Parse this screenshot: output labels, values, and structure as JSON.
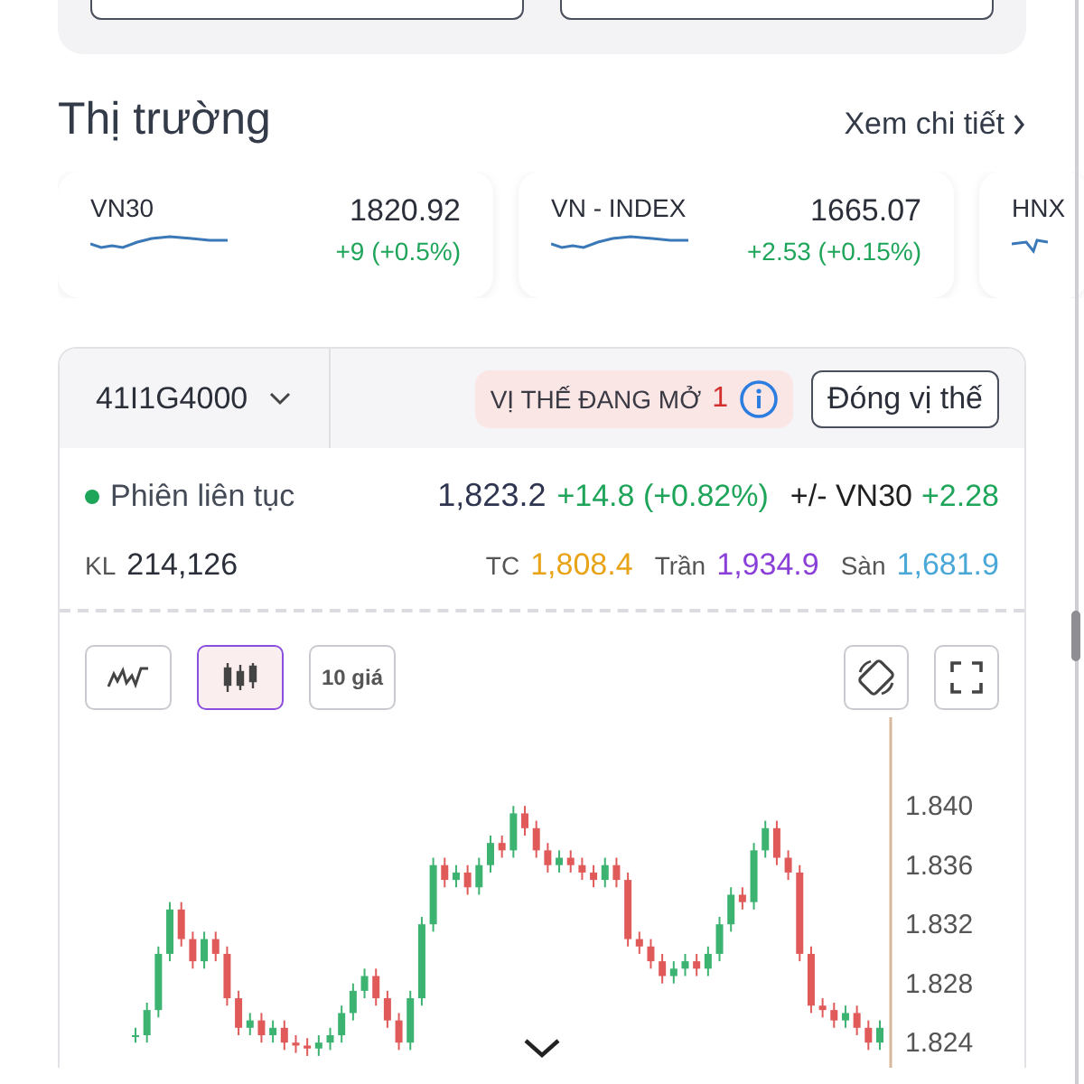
{
  "market": {
    "title": "Thị trường",
    "link": "Xem chi tiết",
    "indices": [
      {
        "name": "VN30",
        "value": "1820.92",
        "change": "+9 (+0.5%)"
      },
      {
        "name": "VN - INDEX",
        "value": "1665.07",
        "change": "+2.53 (+0.15%)"
      },
      {
        "name": "HNX"
      }
    ]
  },
  "contract": {
    "symbol": "41I1G4000",
    "positions_label": "VỊ THẾ ĐANG MỞ",
    "positions_count": "1",
    "close_button": "Đóng vị thế",
    "session": "Phiên liên tục",
    "price": "1,823.2",
    "change": "+14.8 (+0.82%)",
    "basis_label": "+/- VN30",
    "basis": "+2.28",
    "volume_label": "KL",
    "volume": "214,126",
    "ref_label": "TC",
    "ref": "1,808.4",
    "ceiling_label": "Trần",
    "ceiling": "1,934.9",
    "floor_label": "Sàn",
    "floor": "1,681.9"
  },
  "chart_tools": [
    {
      "kind": "line",
      "selected": false
    },
    {
      "kind": "candle",
      "selected": true
    },
    {
      "kind": "text",
      "label": "10 giá",
      "selected": false
    }
  ],
  "chart": {
    "chart_data": {
      "type": "candlestick",
      "ylim": [
        1.8223,
        1.846
      ],
      "yticks": [
        {
          "value": 1.84,
          "label": "1.840"
        },
        {
          "value": 1.836,
          "label": "1.836"
        },
        {
          "value": 1.832,
          "label": "1.832"
        },
        {
          "value": 1.828,
          "label": "1.828"
        },
        {
          "value": 1.824,
          "label": "1.824"
        }
      ],
      "categories": [
        null,
        null,
        null,
        null,
        null,
        null,
        null,
        null,
        null,
        null,
        null,
        null,
        null,
        null,
        null,
        null,
        null,
        null,
        null,
        null,
        null,
        null,
        null,
        null,
        null,
        null,
        null,
        null,
        null,
        null,
        null,
        null,
        null,
        null,
        null,
        null,
        null,
        null,
        null,
        null,
        null,
        null,
        null,
        null,
        null,
        null,
        null,
        null,
        null,
        null,
        null,
        null,
        null,
        null,
        null,
        null,
        null,
        null,
        null,
        null,
        null,
        null,
        null,
        null,
        null,
        null
      ],
      "ohlc": [
        [
          1.8245,
          1.825,
          1.824,
          1.8245
        ],
        [
          1.8245,
          1.8267,
          1.824,
          1.8262
        ],
        [
          1.8262,
          1.8305,
          1.8257,
          1.83
        ],
        [
          1.83,
          1.8335,
          1.8295,
          1.833
        ],
        [
          1.833,
          1.8335,
          1.8305,
          1.831
        ],
        [
          1.831,
          1.8315,
          1.829,
          1.8295
        ],
        [
          1.8295,
          1.8315,
          1.829,
          1.831
        ],
        [
          1.831,
          1.8315,
          1.8295,
          1.83
        ],
        [
          1.83,
          1.8305,
          1.8265,
          1.827
        ],
        [
          1.827,
          1.8275,
          1.8245,
          1.825
        ],
        [
          1.825,
          1.826,
          1.8245,
          1.8255
        ],
        [
          1.8255,
          1.826,
          1.824,
          1.8245
        ],
        [
          1.8245,
          1.8255,
          1.824,
          1.825
        ],
        [
          1.825,
          1.8255,
          1.8235,
          1.824
        ],
        [
          1.824,
          1.8245,
          1.8233,
          1.8238
        ],
        [
          1.8238,
          1.8243,
          1.8231,
          1.8236
        ],
        [
          1.8236,
          1.8245,
          1.8231,
          1.824
        ],
        [
          1.824,
          1.825,
          1.8235,
          1.8245
        ],
        [
          1.8245,
          1.8265,
          1.824,
          1.826
        ],
        [
          1.826,
          1.828,
          1.8255,
          1.8275
        ],
        [
          1.8275,
          1.829,
          1.827,
          1.8285
        ],
        [
          1.8285,
          1.829,
          1.8265,
          1.827
        ],
        [
          1.827,
          1.8275,
          1.825,
          1.8255
        ],
        [
          1.8255,
          1.826,
          1.8235,
          1.824
        ],
        [
          1.824,
          1.8275,
          1.8235,
          1.827
        ],
        [
          1.827,
          1.8325,
          1.8265,
          1.832
        ],
        [
          1.832,
          1.8365,
          1.8315,
          1.836
        ],
        [
          1.836,
          1.8365,
          1.8345,
          1.835
        ],
        [
          1.835,
          1.836,
          1.8345,
          1.8355
        ],
        [
          1.8355,
          1.836,
          1.834,
          1.8345
        ],
        [
          1.8345,
          1.8365,
          1.834,
          1.836
        ],
        [
          1.836,
          1.838,
          1.8355,
          1.8375
        ],
        [
          1.8375,
          1.838,
          1.8365,
          1.837
        ],
        [
          1.837,
          1.84,
          1.8365,
          1.8395
        ],
        [
          1.8395,
          1.84,
          1.838,
          1.8385
        ],
        [
          1.8385,
          1.839,
          1.8365,
          1.837
        ],
        [
          1.837,
          1.8375,
          1.8355,
          1.836
        ],
        [
          1.836,
          1.837,
          1.8355,
          1.8365
        ],
        [
          1.8365,
          1.837,
          1.8355,
          1.836
        ],
        [
          1.836,
          1.8365,
          1.835,
          1.8355
        ],
        [
          1.8355,
          1.836,
          1.8345,
          1.835
        ],
        [
          1.835,
          1.8365,
          1.8345,
          1.836
        ],
        [
          1.836,
          1.8365,
          1.8345,
          1.835
        ],
        [
          1.835,
          1.8355,
          1.8305,
          1.831
        ],
        [
          1.831,
          1.8315,
          1.83,
          1.8305
        ],
        [
          1.8305,
          1.831,
          1.829,
          1.8295
        ],
        [
          1.8295,
          1.83,
          1.828,
          1.8285
        ],
        [
          1.8285,
          1.8295,
          1.828,
          1.829
        ],
        [
          1.829,
          1.83,
          1.8285,
          1.8295
        ],
        [
          1.8295,
          1.83,
          1.8285,
          1.829
        ],
        [
          1.829,
          1.8305,
          1.8285,
          1.83
        ],
        [
          1.83,
          1.8325,
          1.8295,
          1.832
        ],
        [
          1.832,
          1.8345,
          1.8315,
          1.834
        ],
        [
          1.834,
          1.8345,
          1.833,
          1.8335
        ],
        [
          1.8335,
          1.8375,
          1.833,
          1.837
        ],
        [
          1.837,
          1.839,
          1.8365,
          1.8385
        ],
        [
          1.8385,
          1.839,
          1.836,
          1.8365
        ],
        [
          1.8365,
          1.837,
          1.835,
          1.8355
        ],
        [
          1.8355,
          1.836,
          1.8295,
          1.83
        ],
        [
          1.83,
          1.8305,
          1.826,
          1.8265
        ],
        [
          1.8265,
          1.827,
          1.8257,
          1.8262
        ],
        [
          1.8262,
          1.8267,
          1.825,
          1.8255
        ],
        [
          1.8255,
          1.8265,
          1.825,
          1.826
        ],
        [
          1.826,
          1.8265,
          1.8245,
          1.825
        ],
        [
          1.825,
          1.8255,
          1.8235,
          1.824
        ],
        [
          1.824,
          1.8255,
          1.8235,
          1.825
        ]
      ]
    }
  }
}
